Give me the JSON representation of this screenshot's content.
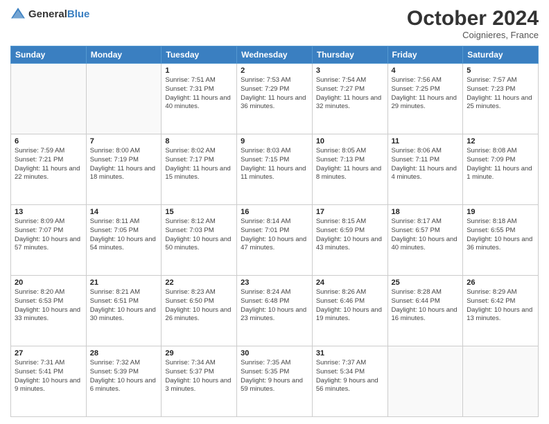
{
  "header": {
    "logo_general": "General",
    "logo_blue": "Blue",
    "month": "October 2024",
    "location": "Coignieres, France"
  },
  "days_of_week": [
    "Sunday",
    "Monday",
    "Tuesday",
    "Wednesday",
    "Thursday",
    "Friday",
    "Saturday"
  ],
  "weeks": [
    [
      {
        "day": "",
        "detail": ""
      },
      {
        "day": "",
        "detail": ""
      },
      {
        "day": "1",
        "detail": "Sunrise: 7:51 AM\nSunset: 7:31 PM\nDaylight: 11 hours and 40 minutes."
      },
      {
        "day": "2",
        "detail": "Sunrise: 7:53 AM\nSunset: 7:29 PM\nDaylight: 11 hours and 36 minutes."
      },
      {
        "day": "3",
        "detail": "Sunrise: 7:54 AM\nSunset: 7:27 PM\nDaylight: 11 hours and 32 minutes."
      },
      {
        "day": "4",
        "detail": "Sunrise: 7:56 AM\nSunset: 7:25 PM\nDaylight: 11 hours and 29 minutes."
      },
      {
        "day": "5",
        "detail": "Sunrise: 7:57 AM\nSunset: 7:23 PM\nDaylight: 11 hours and 25 minutes."
      }
    ],
    [
      {
        "day": "6",
        "detail": "Sunrise: 7:59 AM\nSunset: 7:21 PM\nDaylight: 11 hours and 22 minutes."
      },
      {
        "day": "7",
        "detail": "Sunrise: 8:00 AM\nSunset: 7:19 PM\nDaylight: 11 hours and 18 minutes."
      },
      {
        "day": "8",
        "detail": "Sunrise: 8:02 AM\nSunset: 7:17 PM\nDaylight: 11 hours and 15 minutes."
      },
      {
        "day": "9",
        "detail": "Sunrise: 8:03 AM\nSunset: 7:15 PM\nDaylight: 11 hours and 11 minutes."
      },
      {
        "day": "10",
        "detail": "Sunrise: 8:05 AM\nSunset: 7:13 PM\nDaylight: 11 hours and 8 minutes."
      },
      {
        "day": "11",
        "detail": "Sunrise: 8:06 AM\nSunset: 7:11 PM\nDaylight: 11 hours and 4 minutes."
      },
      {
        "day": "12",
        "detail": "Sunrise: 8:08 AM\nSunset: 7:09 PM\nDaylight: 11 hours and 1 minute."
      }
    ],
    [
      {
        "day": "13",
        "detail": "Sunrise: 8:09 AM\nSunset: 7:07 PM\nDaylight: 10 hours and 57 minutes."
      },
      {
        "day": "14",
        "detail": "Sunrise: 8:11 AM\nSunset: 7:05 PM\nDaylight: 10 hours and 54 minutes."
      },
      {
        "day": "15",
        "detail": "Sunrise: 8:12 AM\nSunset: 7:03 PM\nDaylight: 10 hours and 50 minutes."
      },
      {
        "day": "16",
        "detail": "Sunrise: 8:14 AM\nSunset: 7:01 PM\nDaylight: 10 hours and 47 minutes."
      },
      {
        "day": "17",
        "detail": "Sunrise: 8:15 AM\nSunset: 6:59 PM\nDaylight: 10 hours and 43 minutes."
      },
      {
        "day": "18",
        "detail": "Sunrise: 8:17 AM\nSunset: 6:57 PM\nDaylight: 10 hours and 40 minutes."
      },
      {
        "day": "19",
        "detail": "Sunrise: 8:18 AM\nSunset: 6:55 PM\nDaylight: 10 hours and 36 minutes."
      }
    ],
    [
      {
        "day": "20",
        "detail": "Sunrise: 8:20 AM\nSunset: 6:53 PM\nDaylight: 10 hours and 33 minutes."
      },
      {
        "day": "21",
        "detail": "Sunrise: 8:21 AM\nSunset: 6:51 PM\nDaylight: 10 hours and 30 minutes."
      },
      {
        "day": "22",
        "detail": "Sunrise: 8:23 AM\nSunset: 6:50 PM\nDaylight: 10 hours and 26 minutes."
      },
      {
        "day": "23",
        "detail": "Sunrise: 8:24 AM\nSunset: 6:48 PM\nDaylight: 10 hours and 23 minutes."
      },
      {
        "day": "24",
        "detail": "Sunrise: 8:26 AM\nSunset: 6:46 PM\nDaylight: 10 hours and 19 minutes."
      },
      {
        "day": "25",
        "detail": "Sunrise: 8:28 AM\nSunset: 6:44 PM\nDaylight: 10 hours and 16 minutes."
      },
      {
        "day": "26",
        "detail": "Sunrise: 8:29 AM\nSunset: 6:42 PM\nDaylight: 10 hours and 13 minutes."
      }
    ],
    [
      {
        "day": "27",
        "detail": "Sunrise: 7:31 AM\nSunset: 5:41 PM\nDaylight: 10 hours and 9 minutes."
      },
      {
        "day": "28",
        "detail": "Sunrise: 7:32 AM\nSunset: 5:39 PM\nDaylight: 10 hours and 6 minutes."
      },
      {
        "day": "29",
        "detail": "Sunrise: 7:34 AM\nSunset: 5:37 PM\nDaylight: 10 hours and 3 minutes."
      },
      {
        "day": "30",
        "detail": "Sunrise: 7:35 AM\nSunset: 5:35 PM\nDaylight: 9 hours and 59 minutes."
      },
      {
        "day": "31",
        "detail": "Sunrise: 7:37 AM\nSunset: 5:34 PM\nDaylight: 9 hours and 56 minutes."
      },
      {
        "day": "",
        "detail": ""
      },
      {
        "day": "",
        "detail": ""
      }
    ]
  ]
}
